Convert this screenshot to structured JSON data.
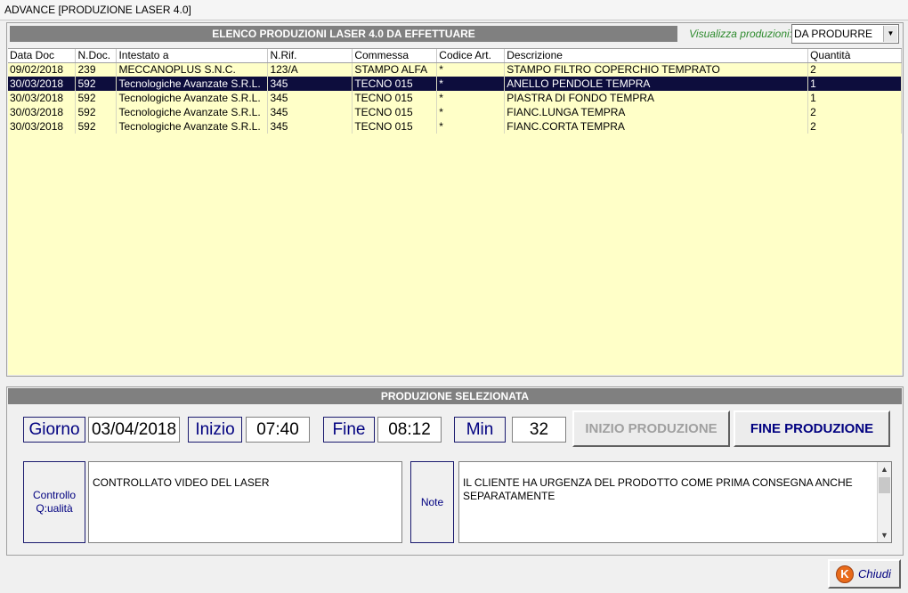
{
  "window": {
    "title": "ADVANCE [PRODUZIONE LASER 4.0]"
  },
  "list": {
    "header": "ELENCO PRODUZIONI LASER 4.0 DA EFFETTUARE",
    "filter_label": "Visualizza produzioni:",
    "filter_value": "DA PRODURRE",
    "columns": [
      "Data Doc",
      "N.Doc.",
      "Intestato a",
      "N.Rif.",
      "Commessa",
      "Codice Art.",
      "Descrizione",
      "Quantità"
    ],
    "rows": [
      [
        "09/02/2018",
        "239",
        "MECCANOPLUS S.N.C.",
        "123/A",
        "STAMPO ALFA",
        "*",
        "STAMPO FILTRO COPERCHIO TEMPRATO",
        "2"
      ],
      [
        "30/03/2018",
        "592",
        "Tecnologiche Avanzate S.R.L.",
        "345",
        "TECNO 015",
        "*",
        "ANELLO PENDOLE TEMPRA",
        "1"
      ],
      [
        "30/03/2018",
        "592",
        "Tecnologiche Avanzate S.R.L.",
        "345",
        "TECNO 015",
        "*",
        "PIASTRA DI FONDO TEMPRA",
        "1"
      ],
      [
        "30/03/2018",
        "592",
        "Tecnologiche Avanzate S.R.L.",
        "345",
        "TECNO 015",
        "*",
        "FIANC.LUNGA TEMPRA",
        "2"
      ],
      [
        "30/03/2018",
        "592",
        "Tecnologiche Avanzate S.R.L.",
        "345",
        "TECNO 015",
        "*",
        "FIANC.CORTA TEMPRA",
        "2"
      ]
    ],
    "selected_row": 1
  },
  "selected": {
    "header": "PRODUZIONE SELEZIONATA",
    "giorno_label": "Giorno",
    "giorno_value": "03/04/2018",
    "inizio_label": "Inizio",
    "inizio_value": "07:40",
    "fine_label": "Fine",
    "fine_value": "08:12",
    "min_label": "Min",
    "min_value": "32",
    "start_button": "INIZIO PRODUZIONE",
    "end_button": "FINE PRODUZIONE",
    "quality_label": "Controllo Q:ualità",
    "quality_text": "CONTROLLATO VIDEO DEL LASER",
    "note_label": "Note",
    "note_text": "IL CLIENTE HA URGENZA DEL PRODOTTO COME PRIMA CONSEGNA ANCHE SEPARATAMENTE"
  },
  "footer": {
    "close_label": "Chiudi",
    "close_icon": "close-circle-icon"
  },
  "colors": {
    "accent": "#000080",
    "selection": "#0d0d3d",
    "list_background": "#ffffc8",
    "header_gray": "#808080",
    "filter_label": "#2e8b2e"
  }
}
